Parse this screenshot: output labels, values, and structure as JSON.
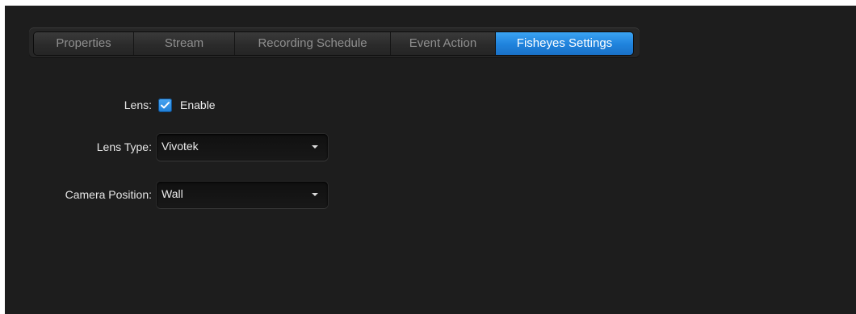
{
  "tabs": [
    {
      "label": "Properties",
      "active": false
    },
    {
      "label": "Stream",
      "active": false
    },
    {
      "label": "Recording Schedule",
      "active": false
    },
    {
      "label": "Event Action",
      "active": false
    },
    {
      "label": "Fisheyes Settings",
      "active": true
    }
  ],
  "form": {
    "lens": {
      "label": "Lens:",
      "checkbox_label": "Enable",
      "checked": true
    },
    "lens_type": {
      "label": "Lens Type:",
      "value": "Vivotek"
    },
    "camera_position": {
      "label": "Camera Position:",
      "value": "Wall"
    }
  },
  "colors": {
    "background": "#1d1d1d",
    "accent": "#1f82dc",
    "text": "#e6e6e6",
    "inactive_tab_text": "#8f8f8f"
  },
  "icons": {
    "checkbox": "checkmark-icon",
    "dropdown": "chevron-down-icon"
  }
}
